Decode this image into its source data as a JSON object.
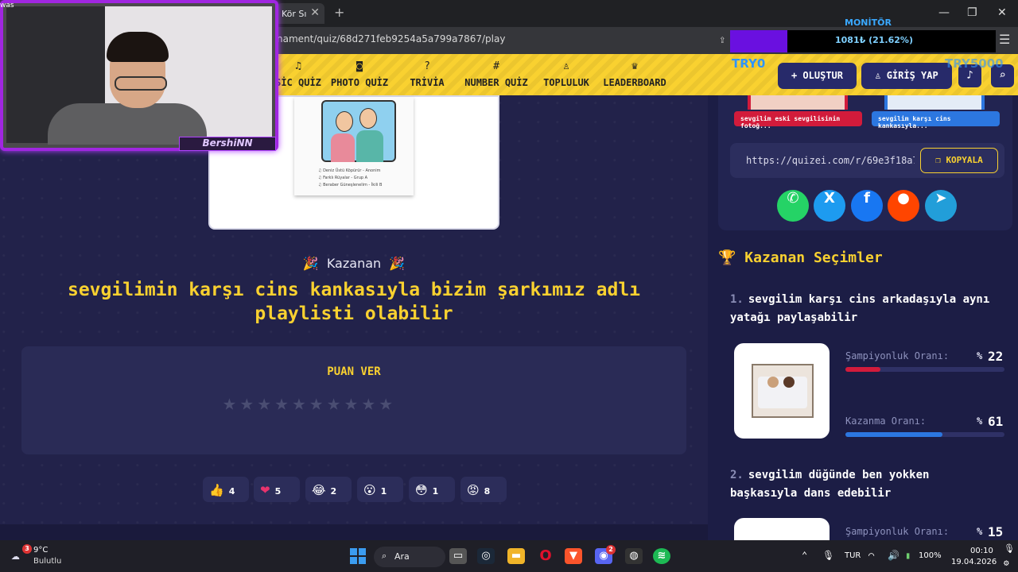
{
  "browser": {
    "tab_title": "Kör Sı",
    "url": "nament/quiz/68d271feb9254a5a799a7867/play"
  },
  "overlay": {
    "monitor_label": "MONİTÖR",
    "monitor_text": "1081₺ (21.62%)",
    "monitor_progress": 0.2162,
    "try_start": "TRY0",
    "try_goal": "TRY5000",
    "webcam_name": "BershiNN",
    "corner_text": "was"
  },
  "nav": {
    "items": [
      {
        "icon": "music-icon",
        "glyph": "♫",
        "label": "SİC QUİZ"
      },
      {
        "icon": "camera-icon",
        "glyph": "◙",
        "label": "PHOTO QUİZ"
      },
      {
        "icon": "question-icon",
        "glyph": "?",
        "label": "TRİVİA"
      },
      {
        "icon": "hash-icon",
        "glyph": "#",
        "label": "NUMBER QUİZ"
      },
      {
        "icon": "users-icon",
        "glyph": "♙",
        "label": "TOPLULUK"
      },
      {
        "icon": "trophy-icon",
        "glyph": "♛",
        "label": "LEADERBOARD"
      }
    ],
    "create_label": "+ OLUŞTUR",
    "login_label": "♙ GİRİŞ YAP"
  },
  "main": {
    "playlist_lines": [
      "♫ Deniz Üstü Köpürür - Anonim",
      "♫ Farklı Rüyalar - Grup A",
      "♫ Beraber Güneşlenelim - İkili B"
    ],
    "winner_label": "Kazanan",
    "winner_title": "sevgilimin karşı cins kankasıyla bizim şarkımız adlı playlisti olabilir",
    "rate_label": "PUAN VER",
    "stars_total": 10,
    "stars_value": 0,
    "reactions": [
      {
        "emoji": "👍",
        "count": "4"
      },
      {
        "emoji": "❤",
        "count": "5"
      },
      {
        "emoji": "😂",
        "count": "2"
      },
      {
        "emoji": "😮",
        "count": "1"
      },
      {
        "emoji": "😳",
        "count": "1"
      },
      {
        "emoji": "😡",
        "count": "8"
      }
    ]
  },
  "sidebar": {
    "pill1": "sevgilim eski sevgilisinin fotoğ...",
    "pill2": "sevgilim karşı cins kankasıyla...",
    "share_link": "https://quizei.com/r/69e3f18a7",
    "copy_label": "KOPYALA",
    "socials": [
      {
        "name": "whatsapp-icon",
        "glyph": "✆",
        "color": "#25d366"
      },
      {
        "name": "x-icon",
        "glyph": "X",
        "color": "#1d9bf0"
      },
      {
        "name": "facebook-icon",
        "glyph": "f",
        "color": "#1877f2"
      },
      {
        "name": "reddit-icon",
        "glyph": "●",
        "color": "#ff4500"
      },
      {
        "name": "telegram-icon",
        "glyph": "➤",
        "color": "#229ed9"
      }
    ],
    "selections_title": "Kazanan Seçimler",
    "items": [
      {
        "num": "1.",
        "title": "sevgilim karşı cins arkadaşıyla aynı yatağı paylaşabilir",
        "champ_label": "Şampiyonluk Oranı:",
        "champ_pct": "%",
        "champ_value": "22",
        "win_label": "Kazanma Oranı:",
        "win_pct": "%",
        "win_value": "61"
      },
      {
        "num": "2.",
        "title": "sevgilim düğünde ben yokken başkasıyla dans edebilir",
        "champ_label": "Şampiyonluk Oranı:",
        "champ_pct": "%",
        "champ_value": "15"
      }
    ]
  },
  "taskbar": {
    "weather_badge": "3",
    "temp": "9°C",
    "weather_desc": "Bulutlu",
    "search_label": "Ara",
    "lang": "TUR",
    "battery": "100%",
    "time": "00:10",
    "date": "19.04.2026",
    "discord_badge": "2"
  },
  "colors": {
    "accent": "#f9d130",
    "panel": "#22224a",
    "red": "#d21b3b",
    "blue": "#2c77e0"
  }
}
